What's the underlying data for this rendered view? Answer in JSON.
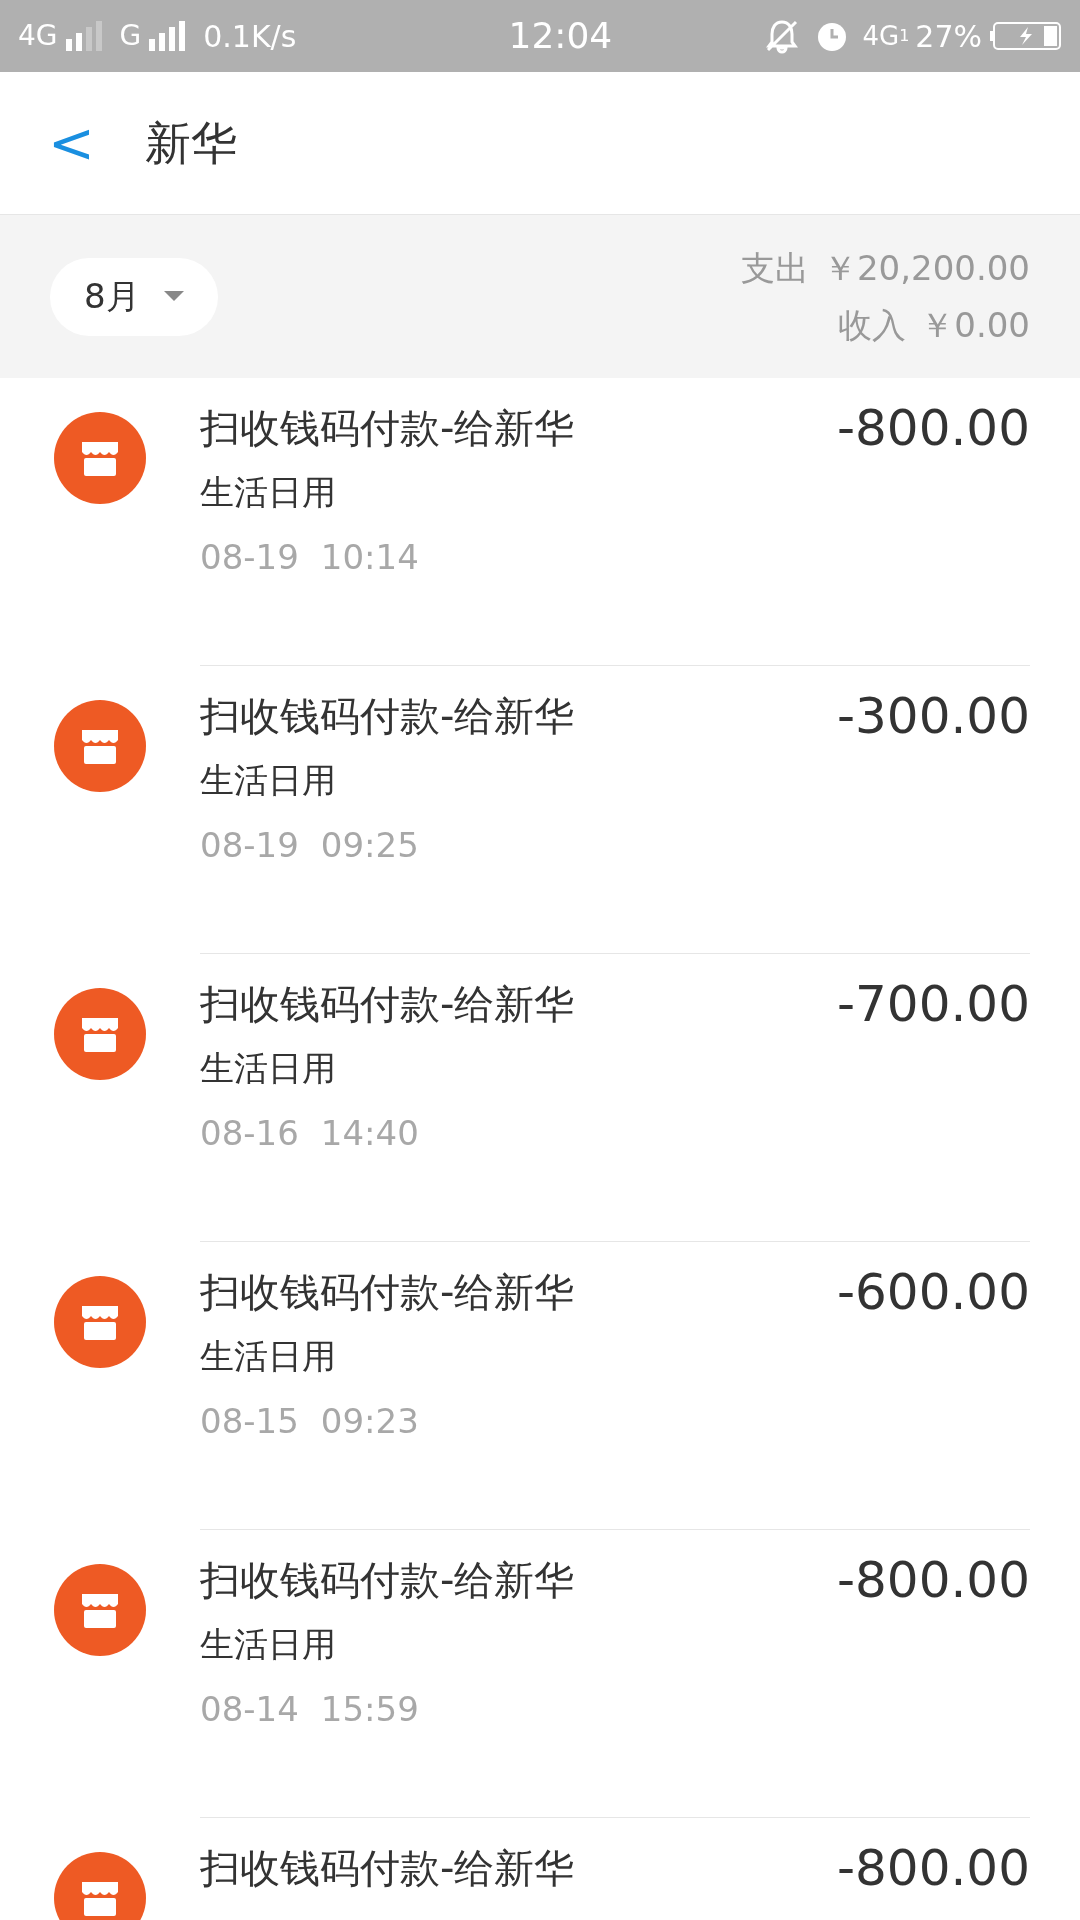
{
  "status_bar": {
    "carrier_1": "4G",
    "carrier_2": "G",
    "speed": "0.1K/s",
    "time": "12:04",
    "network": "4G",
    "sim": "1",
    "battery": "27%"
  },
  "header": {
    "back": "<",
    "title": "新华"
  },
  "filter": {
    "month": "8月",
    "expense_label": "支出",
    "expense": "￥20,200.00",
    "income_label": "收入",
    "income": "￥0.00"
  },
  "transactions": [
    {
      "title": "扫收钱码付款-给新华",
      "category": "生活日用",
      "date": "08-19",
      "time": "10:14",
      "amount": "-800.00"
    },
    {
      "title": "扫收钱码付款-给新华",
      "category": "生活日用",
      "date": "08-19",
      "time": "09:25",
      "amount": "-300.00"
    },
    {
      "title": "扫收钱码付款-给新华",
      "category": "生活日用",
      "date": "08-16",
      "time": "14:40",
      "amount": "-700.00"
    },
    {
      "title": "扫收钱码付款-给新华",
      "category": "生活日用",
      "date": "08-15",
      "time": "09:23",
      "amount": "-600.00"
    },
    {
      "title": "扫收钱码付款-给新华",
      "category": "生活日用",
      "date": "08-14",
      "time": "15:59",
      "amount": "-800.00"
    },
    {
      "title": "扫收钱码付款-给新华",
      "amount": "-800.00"
    }
  ]
}
